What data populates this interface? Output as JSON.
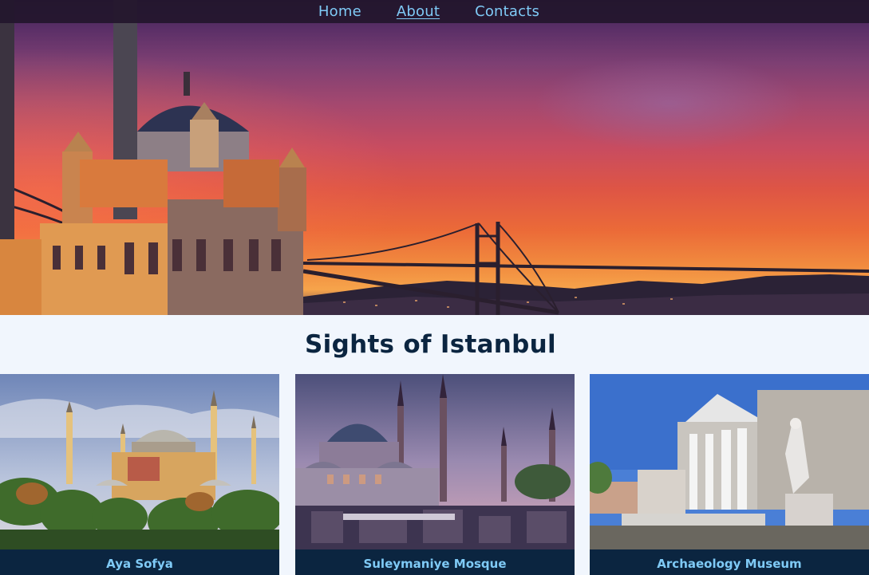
{
  "nav": {
    "items": [
      {
        "label": "Home",
        "active": false
      },
      {
        "label": "About",
        "active": true
      },
      {
        "label": "Contacts",
        "active": false
      }
    ]
  },
  "hero": {
    "image": "istanbul-sunset-mosque-bridge"
  },
  "page_title": "Sights of Istanbul",
  "cards": [
    {
      "image": "aya-sofya-photo",
      "caption": "Aya Sofya"
    },
    {
      "image": "suleymaniye-mosque-photo",
      "caption": "Suleymaniye Mosque"
    },
    {
      "image": "archaeology-museum-photo",
      "caption": "Archaeology Museum"
    }
  ],
  "colors": {
    "nav_background": "#23162d",
    "link": "#7fcaf6",
    "page_background": "#f1f6fd",
    "title": "#0b2540",
    "caption_background": "#0b2540"
  }
}
